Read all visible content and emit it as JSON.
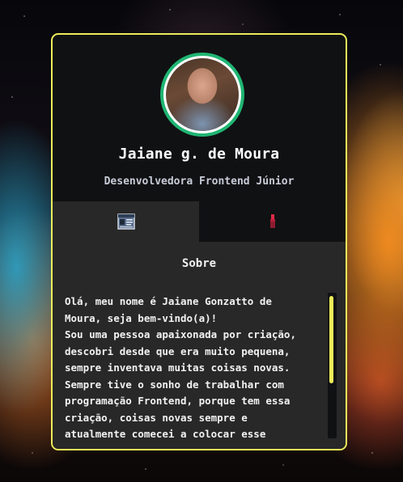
{
  "profile": {
    "name": "Jaiane g. de Moura",
    "role": "Desenvolvedora Frontend Júnior",
    "avatar_icon": "profile-photo"
  },
  "tabs": [
    {
      "icon": "id-card-icon",
      "active": true
    },
    {
      "icon": "lipstick-icon",
      "active": false
    }
  ],
  "about": {
    "title": "Sobre",
    "text": "Olá, meu nome é Jaiane Gonzatto de\nMoura, seja bem-vindo(a)!\nSou uma pessoa apaixonada por criação,\ndescobri desde que era muito pequena,\nsempre inventava muitas coisas novas.\nSempre tive o sonho de trabalhar com\nprogramação Frontend, porque tem essa\ncriação, coisas novas sempre e\natualmente comecei a colocar esse"
  },
  "colors": {
    "border": "#ecec5a",
    "avatar_ring": "#1fb572",
    "card_bg": "#101113",
    "panel_bg": "#282828"
  }
}
